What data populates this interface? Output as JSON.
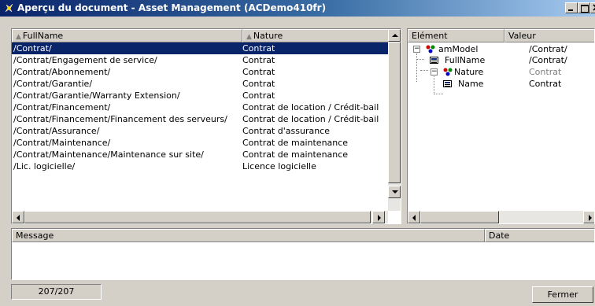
{
  "window": {
    "title": "Aperçu du document - Asset Management (ACDemo410fr)",
    "minimize_label": "_",
    "maximize_label": "□",
    "close_label": "×"
  },
  "list": {
    "headers": {
      "fullname": "FullName",
      "nature": "Nature"
    },
    "rows": [
      {
        "fullname": "/Contrat/",
        "nature": "Contrat"
      },
      {
        "fullname": "/Contrat/Engagement de service/",
        "nature": "Contrat"
      },
      {
        "fullname": "/Contrat/Abonnement/",
        "nature": "Contrat"
      },
      {
        "fullname": "/Contrat/Garantie/",
        "nature": "Contrat"
      },
      {
        "fullname": "/Contrat/Garantie/Warranty Extension/",
        "nature": "Contrat"
      },
      {
        "fullname": "/Contrat/Financement/",
        "nature": "Contrat de location / Crédit-bail"
      },
      {
        "fullname": "/Contrat/Financement/Financement des serveurs/",
        "nature": "Contrat de location / Crédit-bail"
      },
      {
        "fullname": "/Contrat/Assurance/",
        "nature": "Contrat d'assurance"
      },
      {
        "fullname": "/Contrat/Maintenance/",
        "nature": "Contrat de maintenance"
      },
      {
        "fullname": "/Contrat/Maintenance/Maintenance sur site/",
        "nature": "Contrat de maintenance"
      },
      {
        "fullname": "/Lic. logicielle/",
        "nature": "Licence logicielle"
      }
    ]
  },
  "tree": {
    "headers": {
      "element": "Elément",
      "value": "Valeur"
    },
    "nodes": [
      {
        "label": "amModel",
        "value": "/Contrat/"
      },
      {
        "label": "FullName",
        "value": "/Contrat/"
      },
      {
        "label": "Nature",
        "value": "Contrat"
      },
      {
        "label": "Name",
        "value": "Contrat"
      }
    ]
  },
  "messages": {
    "headers": {
      "message": "Message",
      "date": "Date"
    }
  },
  "status": {
    "count": "207/207"
  },
  "buttons": {
    "close": "Fermer"
  },
  "colors": {
    "selection": "#0a246a",
    "title_start": "#0a246a",
    "title_end": "#a6caf0",
    "face": "#d4d0c8"
  }
}
